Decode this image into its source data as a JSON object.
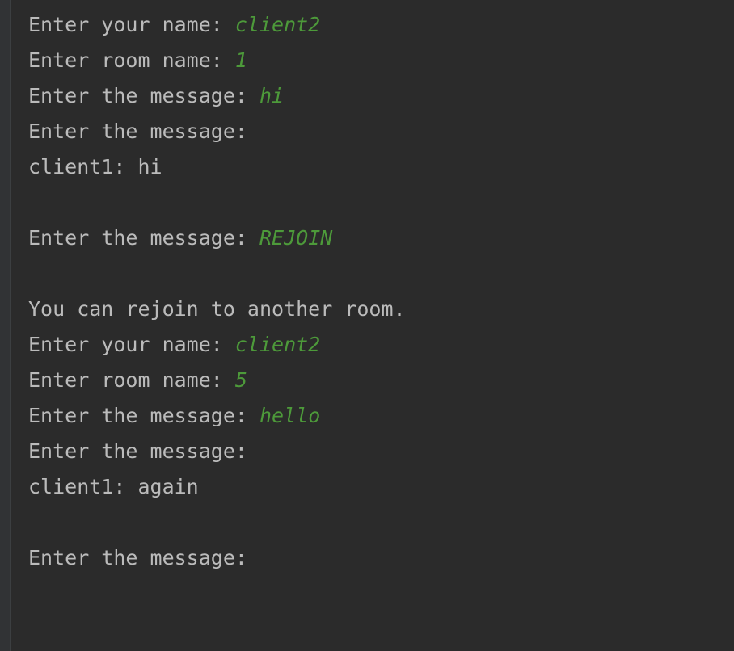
{
  "console": {
    "lines": [
      {
        "prompt": "Enter your name: ",
        "input": "client2"
      },
      {
        "prompt": "Enter room name: ",
        "input": "1"
      },
      {
        "prompt": "Enter the message: ",
        "input": "hi"
      },
      {
        "prompt": "Enter the message: ",
        "input": ""
      },
      {
        "prompt": "client1: hi",
        "input": ""
      },
      {
        "prompt": "",
        "input": ""
      },
      {
        "prompt": "Enter the message: ",
        "input": "REJOIN"
      },
      {
        "prompt": "",
        "input": ""
      },
      {
        "prompt": "You can rejoin to another room.",
        "input": ""
      },
      {
        "prompt": "Enter your name: ",
        "input": "client2"
      },
      {
        "prompt": "Enter room name: ",
        "input": "5"
      },
      {
        "prompt": "Enter the message: ",
        "input": "hello"
      },
      {
        "prompt": "Enter the message: ",
        "input": ""
      },
      {
        "prompt": "client1: again",
        "input": ""
      },
      {
        "prompt": "",
        "input": ""
      },
      {
        "prompt": "Enter the message: ",
        "input": ""
      }
    ]
  },
  "colors": {
    "background": "#2b2b2b",
    "text": "#bbbbbb",
    "user_input": "#4d9a3a"
  }
}
